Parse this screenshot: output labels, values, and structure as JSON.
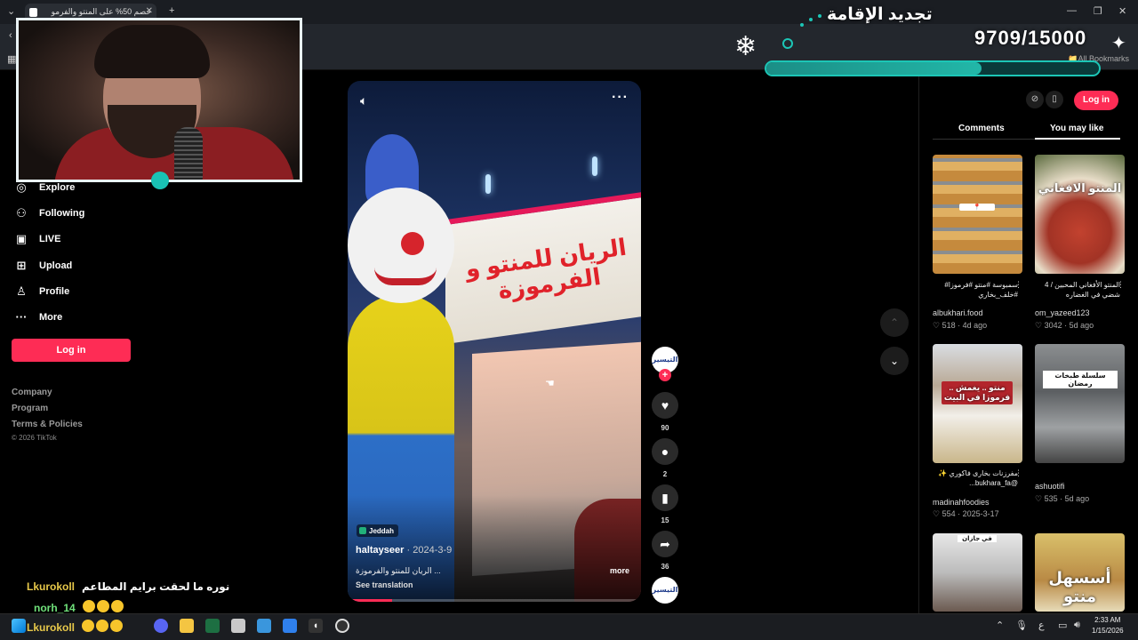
{
  "browser": {
    "tab_title": "خصم 50% على المنتو والفرمو",
    "bookmarks_label": "All Bookmarks"
  },
  "stream": {
    "goal_title": "تجديد الإقامة",
    "goal_count": "9709/15000",
    "goal_progress": 0.647
  },
  "sidebar": {
    "items": [
      {
        "label": "Explore",
        "icon": "compass-icon"
      },
      {
        "label": "Following",
        "icon": "following-icon"
      },
      {
        "label": "LIVE",
        "icon": "live-icon"
      },
      {
        "label": "Upload",
        "icon": "upload-icon"
      },
      {
        "label": "Profile",
        "icon": "profile-icon"
      },
      {
        "label": "More",
        "icon": "more-icon"
      }
    ],
    "login_label": "Log in",
    "footer_links": [
      "Company",
      "Program",
      "Terms & Policies"
    ],
    "copyright": "© 2026 TikTok"
  },
  "video": {
    "sign_text": "الريان للمنتو و الفرموزة",
    "location": "Jeddah",
    "author": "haltayseer",
    "date": "· 2024-3-9",
    "caption": "... الريان للمنتو والفرموزة",
    "more_label": "more",
    "translate_label": "See translation",
    "avatar_text": "التيسير",
    "likes": "90",
    "comments": "2",
    "saves": "15",
    "shares": "36",
    "progress": 0.15
  },
  "right_panel": {
    "login_label": "Log in",
    "tabs": [
      "Comments",
      "You may like"
    ],
    "cards": [
      {
        "thumb_text": "",
        "title": "سمبوسة #منتو #فرموزا# #خلف_بخاري",
        "user": "albukhari.food",
        "likes": "518",
        "time": "4d ago"
      },
      {
        "thumb_text": "المنتو الافغاني",
        "title": "المنتو الأفغاني المحبين / 4 شضي في الغضاره",
        "user": "om_yazeed123",
        "likes": "3042",
        "time": "5d ago"
      },
      {
        "thumb_text": "منتو .. يغمش .. فرموزا في البيت",
        "title": "مفرزنات بخارى فاكوري ✨ @bukhara_fa...",
        "user": "madinahfoodies",
        "likes": "554",
        "time": "2025-3-17"
      },
      {
        "thumb_text": "سلسلة طبخات رمضان",
        "title": "",
        "user": "ashuotifi",
        "likes": "535",
        "time": "5d ago"
      },
      {
        "thumb_text": "في جازان",
        "title": "",
        "user": "",
        "likes": "",
        "time": ""
      },
      {
        "thumb_text": "أسسهل منتو",
        "title": "",
        "user": "",
        "likes": "",
        "time": ""
      }
    ]
  },
  "chat": [
    {
      "name": "Lkurokoll",
      "message": "نوره ما لحقت برايم المطاعم"
    },
    {
      "name": "norh_14",
      "message": ""
    },
    {
      "name": "Lkurokoll",
      "message": ""
    }
  ],
  "taskbar": {
    "time": "2:33 AM",
    "date": "1/15/2026",
    "lang": "ع"
  }
}
